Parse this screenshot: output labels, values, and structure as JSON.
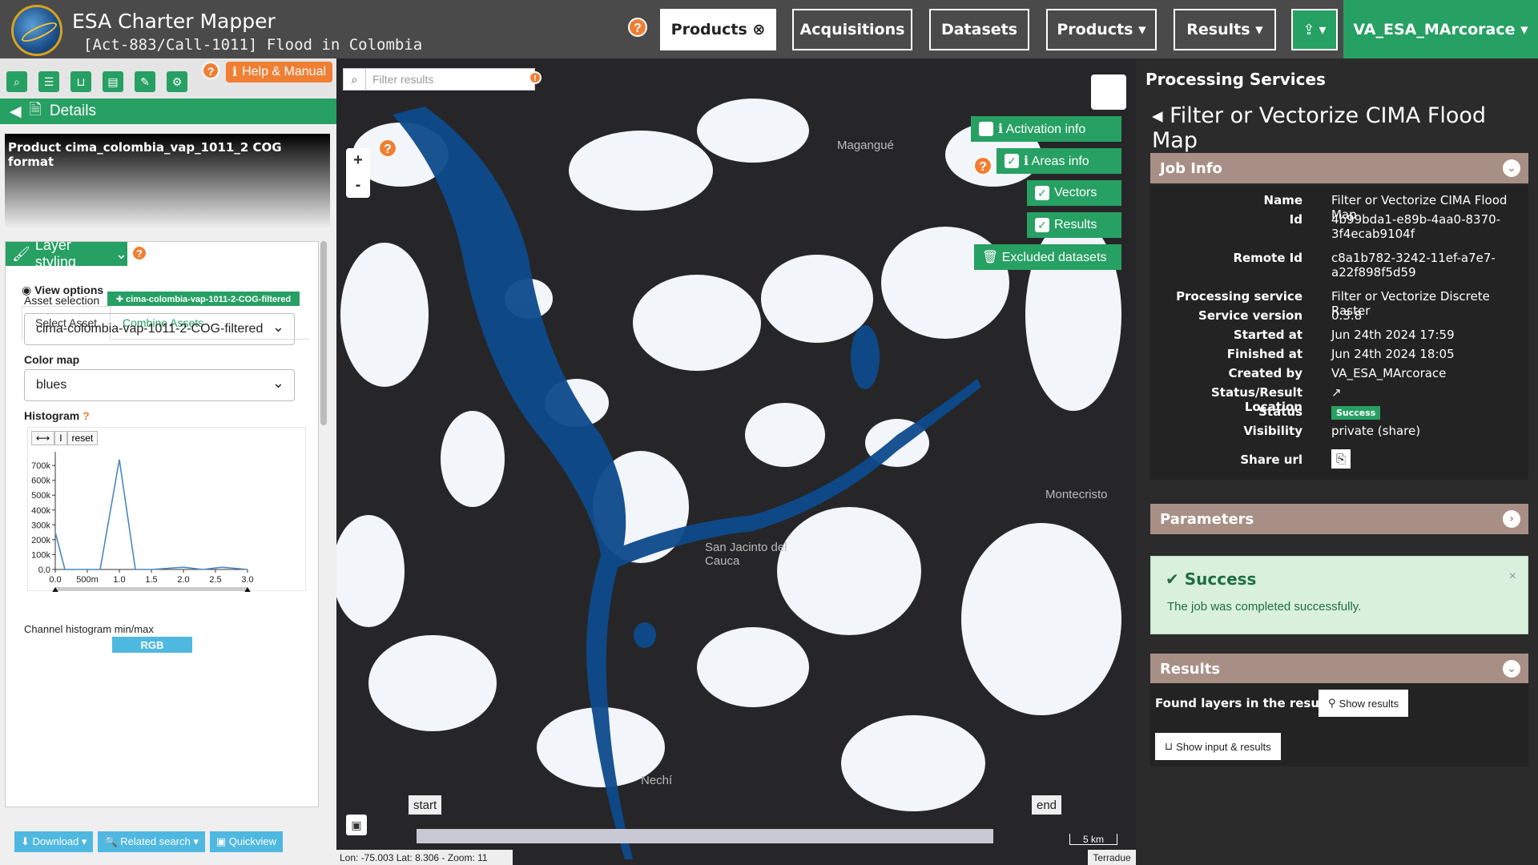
{
  "header": {
    "app_title": "ESA Charter Mapper",
    "subtitle": "[Act-883/Call-1011] Flood in Colombia",
    "help": "?",
    "nav": [
      {
        "label": "Products ⊗"
      },
      {
        "label": "Acquisitions"
      },
      {
        "label": "Datasets"
      },
      {
        "label": "Products ▾"
      },
      {
        "label": "Results ▾"
      },
      {
        "label": "⇪ ▾"
      }
    ],
    "user": "VA_ESA_MArcorace ▾",
    "colors": {
      "accent": "#27a063",
      "bar": "#4a4a4a",
      "help": "#f07f34"
    }
  },
  "left": {
    "help_manual": "Help & Manual",
    "details": "Details",
    "product_title": "Product cima_colombia_vap_1011_2 COG format",
    "layer_styling": "Layer styling",
    "view_options": "View options",
    "tabs": [
      "Select Asset",
      "Combine Assets"
    ],
    "asset_selection_label": "Asset selection",
    "asset_badge": "✚ cima-colombia-vap-1011-2-COG-filtered",
    "asset_value": "cima-colombia-vap-1011-2-COG-filtered",
    "color_map_label": "Color map",
    "color_map_value": "blues",
    "histogram_label": "Histogram",
    "hist_buttons": [
      "⟷",
      "I",
      "reset"
    ],
    "channel_label": "Channel histogram min/max",
    "rgb": "RGB",
    "bottom_buttons": [
      "⬇ Download ▾",
      "🔍 Related search ▾",
      "▣ Quickview"
    ]
  },
  "chart_data": {
    "type": "line",
    "title": "",
    "x": [
      0.0,
      0.15,
      0.4,
      0.7,
      1.0,
      1.25,
      1.5,
      2.0,
      2.3,
      2.6,
      3.0
    ],
    "values": [
      250000,
      0,
      0,
      0,
      740000,
      0,
      0,
      15000,
      0,
      15000,
      0
    ],
    "x_ticks": [
      "0.0",
      "500m",
      "1.0",
      "1.5",
      "2.0",
      "2.5",
      "3.0"
    ],
    "y_ticks": [
      "0.0",
      "100k",
      "200k",
      "300k",
      "400k",
      "500k",
      "600k",
      "700k"
    ],
    "xlim": [
      0,
      3.0
    ],
    "ylim": [
      0,
      760000
    ]
  },
  "map": {
    "filter_placeholder": "Filter results",
    "zoom_in": "+",
    "zoom_out": "-",
    "overlay_buttons": [
      {
        "label": "ℹ Activation info",
        "checked": false
      },
      {
        "label": "ℹ Areas info",
        "checked": true
      },
      {
        "label": "Vectors",
        "checked": true
      },
      {
        "label": "Results",
        "checked": true
      }
    ],
    "excluded": "🗑 Excluded datasets",
    "places": [
      "Magangué",
      "Montecristo",
      "San Jacinto del Cauca",
      "Nechí"
    ],
    "timeline_start": "start",
    "timeline_end": "end",
    "scale": "5 km",
    "coords": "Lon: -75.003 Lat: 8.306 - Zoom: 11",
    "attribution": "Terradue"
  },
  "right": {
    "title": "Processing Services",
    "service": "Filter or Vectorize CIMA Flood Map",
    "job_info": "Job Info",
    "fields": [
      {
        "k": "Name",
        "v": "Filter or Vectorize CIMA Flood Map"
      },
      {
        "k": "Id",
        "v": "4b99bda1-e89b-4aa0-8370-3f4ecab9104f"
      },
      {
        "k": "Remote Id",
        "v": "c8a1b782-3242-11ef-a7e7-a22f898f5d59"
      },
      {
        "k": "Processing service",
        "v": "Filter or Vectorize Discrete Raster"
      },
      {
        "k": "Service version",
        "v": "0.3.8"
      },
      {
        "k": "Started at",
        "v": "Jun 24th 2024 17:59"
      },
      {
        "k": "Finished at",
        "v": "Jun 24th 2024 18:05"
      },
      {
        "k": "Created by",
        "v": "VA_ESA_MArcorace"
      },
      {
        "k": "Status/Result Location",
        "v": "↗"
      },
      {
        "k": "Status",
        "v": "Success"
      },
      {
        "k": "Visibility",
        "v": "private (share)"
      },
      {
        "k": "Share url",
        "v": "⎘"
      }
    ],
    "parameters": "Parameters",
    "success_title": "Success",
    "success_text": "The job was completed successfully.",
    "results": "Results",
    "found_layers": "Found layers in the result.",
    "show_results": "Show results",
    "show_input": "Show input & results"
  }
}
